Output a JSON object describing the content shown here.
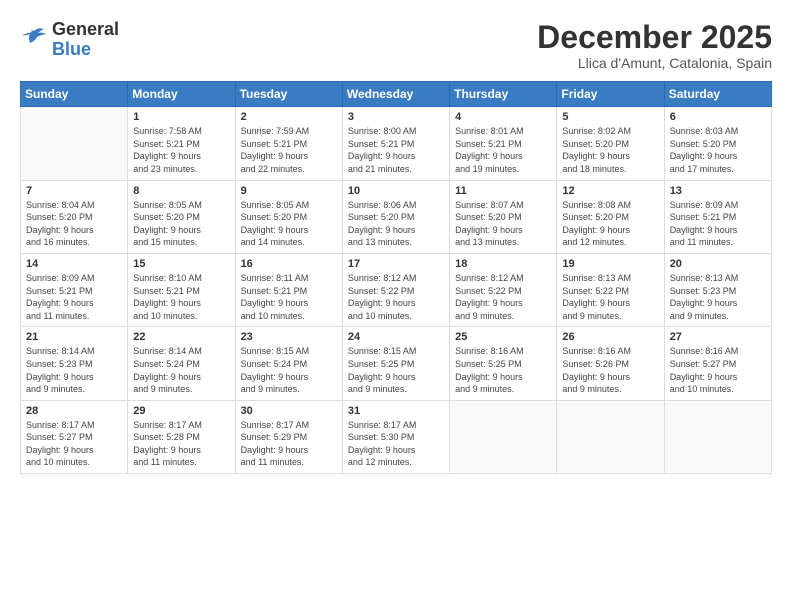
{
  "logo": {
    "general": "General",
    "blue": "Blue"
  },
  "title": "December 2025",
  "location": "Llica d'Amunt, Catalonia, Spain",
  "headers": [
    "Sunday",
    "Monday",
    "Tuesday",
    "Wednesday",
    "Thursday",
    "Friday",
    "Saturday"
  ],
  "weeks": [
    [
      {
        "day": "",
        "info": ""
      },
      {
        "day": "1",
        "info": "Sunrise: 7:58 AM\nSunset: 5:21 PM\nDaylight: 9 hours\nand 23 minutes."
      },
      {
        "day": "2",
        "info": "Sunrise: 7:59 AM\nSunset: 5:21 PM\nDaylight: 9 hours\nand 22 minutes."
      },
      {
        "day": "3",
        "info": "Sunrise: 8:00 AM\nSunset: 5:21 PM\nDaylight: 9 hours\nand 21 minutes."
      },
      {
        "day": "4",
        "info": "Sunrise: 8:01 AM\nSunset: 5:21 PM\nDaylight: 9 hours\nand 19 minutes."
      },
      {
        "day": "5",
        "info": "Sunrise: 8:02 AM\nSunset: 5:20 PM\nDaylight: 9 hours\nand 18 minutes."
      },
      {
        "day": "6",
        "info": "Sunrise: 8:03 AM\nSunset: 5:20 PM\nDaylight: 9 hours\nand 17 minutes."
      }
    ],
    [
      {
        "day": "7",
        "info": "Sunrise: 8:04 AM\nSunset: 5:20 PM\nDaylight: 9 hours\nand 16 minutes."
      },
      {
        "day": "8",
        "info": "Sunrise: 8:05 AM\nSunset: 5:20 PM\nDaylight: 9 hours\nand 15 minutes."
      },
      {
        "day": "9",
        "info": "Sunrise: 8:05 AM\nSunset: 5:20 PM\nDaylight: 9 hours\nand 14 minutes."
      },
      {
        "day": "10",
        "info": "Sunrise: 8:06 AM\nSunset: 5:20 PM\nDaylight: 9 hours\nand 13 minutes."
      },
      {
        "day": "11",
        "info": "Sunrise: 8:07 AM\nSunset: 5:20 PM\nDaylight: 9 hours\nand 13 minutes."
      },
      {
        "day": "12",
        "info": "Sunrise: 8:08 AM\nSunset: 5:20 PM\nDaylight: 9 hours\nand 12 minutes."
      },
      {
        "day": "13",
        "info": "Sunrise: 8:09 AM\nSunset: 5:21 PM\nDaylight: 9 hours\nand 11 minutes."
      }
    ],
    [
      {
        "day": "14",
        "info": "Sunrise: 8:09 AM\nSunset: 5:21 PM\nDaylight: 9 hours\nand 11 minutes."
      },
      {
        "day": "15",
        "info": "Sunrise: 8:10 AM\nSunset: 5:21 PM\nDaylight: 9 hours\nand 10 minutes."
      },
      {
        "day": "16",
        "info": "Sunrise: 8:11 AM\nSunset: 5:21 PM\nDaylight: 9 hours\nand 10 minutes."
      },
      {
        "day": "17",
        "info": "Sunrise: 8:12 AM\nSunset: 5:22 PM\nDaylight: 9 hours\nand 10 minutes."
      },
      {
        "day": "18",
        "info": "Sunrise: 8:12 AM\nSunset: 5:22 PM\nDaylight: 9 hours\nand 9 minutes."
      },
      {
        "day": "19",
        "info": "Sunrise: 8:13 AM\nSunset: 5:22 PM\nDaylight: 9 hours\nand 9 minutes."
      },
      {
        "day": "20",
        "info": "Sunrise: 8:13 AM\nSunset: 5:23 PM\nDaylight: 9 hours\nand 9 minutes."
      }
    ],
    [
      {
        "day": "21",
        "info": "Sunrise: 8:14 AM\nSunset: 5:23 PM\nDaylight: 9 hours\nand 9 minutes."
      },
      {
        "day": "22",
        "info": "Sunrise: 8:14 AM\nSunset: 5:24 PM\nDaylight: 9 hours\nand 9 minutes."
      },
      {
        "day": "23",
        "info": "Sunrise: 8:15 AM\nSunset: 5:24 PM\nDaylight: 9 hours\nand 9 minutes."
      },
      {
        "day": "24",
        "info": "Sunrise: 8:15 AM\nSunset: 5:25 PM\nDaylight: 9 hours\nand 9 minutes."
      },
      {
        "day": "25",
        "info": "Sunrise: 8:16 AM\nSunset: 5:25 PM\nDaylight: 9 hours\nand 9 minutes."
      },
      {
        "day": "26",
        "info": "Sunrise: 8:16 AM\nSunset: 5:26 PM\nDaylight: 9 hours\nand 9 minutes."
      },
      {
        "day": "27",
        "info": "Sunrise: 8:16 AM\nSunset: 5:27 PM\nDaylight: 9 hours\nand 10 minutes."
      }
    ],
    [
      {
        "day": "28",
        "info": "Sunrise: 8:17 AM\nSunset: 5:27 PM\nDaylight: 9 hours\nand 10 minutes."
      },
      {
        "day": "29",
        "info": "Sunrise: 8:17 AM\nSunset: 5:28 PM\nDaylight: 9 hours\nand 11 minutes."
      },
      {
        "day": "30",
        "info": "Sunrise: 8:17 AM\nSunset: 5:29 PM\nDaylight: 9 hours\nand 11 minutes."
      },
      {
        "day": "31",
        "info": "Sunrise: 8:17 AM\nSunset: 5:30 PM\nDaylight: 9 hours\nand 12 minutes."
      },
      {
        "day": "",
        "info": ""
      },
      {
        "day": "",
        "info": ""
      },
      {
        "day": "",
        "info": ""
      }
    ]
  ]
}
